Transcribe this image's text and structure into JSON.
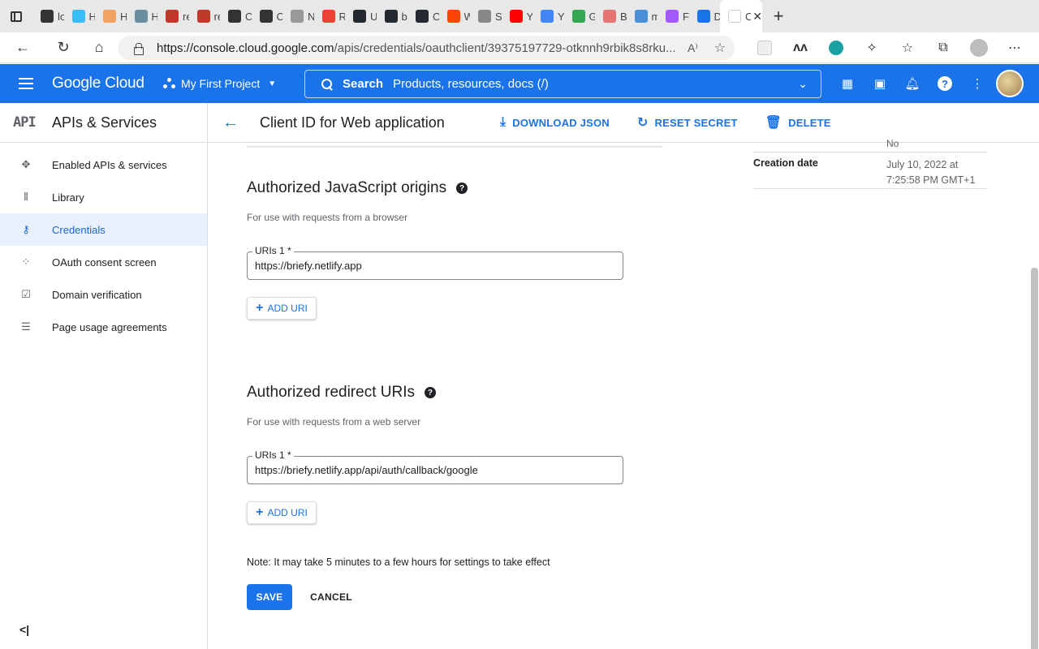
{
  "browser": {
    "tabs": [
      {
        "title": "loc",
        "color": "#333333"
      },
      {
        "title": "Ha",
        "color": "#38bdf8"
      },
      {
        "title": "Ho",
        "color": "#f4a261"
      },
      {
        "title": "Ho",
        "color": "#6b8e9f"
      },
      {
        "title": "re",
        "color": "#c0392b"
      },
      {
        "title": "re",
        "color": "#c0392b"
      },
      {
        "title": "Co",
        "color": "#333333"
      },
      {
        "title": "Co",
        "color": "#333333"
      },
      {
        "title": "Ne",
        "color": "#999999"
      },
      {
        "title": "Re",
        "color": "#ea4335"
      },
      {
        "title": "Us",
        "color": "#24292f"
      },
      {
        "title": "br",
        "color": "#24292f"
      },
      {
        "title": "Or",
        "color": "#24292f"
      },
      {
        "title": "W",
        "color": "#ff4500"
      },
      {
        "title": "Se",
        "color": "#888888"
      },
      {
        "title": "Yo",
        "color": "#ff0000"
      },
      {
        "title": "Yo",
        "color": "#4285f4"
      },
      {
        "title": "Go",
        "color": "#34a853"
      },
      {
        "title": "Bi",
        "color": "#e57373"
      },
      {
        "title": "ms",
        "color": "#4a90d9"
      },
      {
        "title": "Fig",
        "color": "#a259ff"
      },
      {
        "title": "De",
        "color": "#1a73e8"
      },
      {
        "title": "Cli",
        "color": "#ffffff"
      }
    ],
    "url_host": "https://console.cloud.google.com",
    "url_path": "/apis/credentials/oauthclient/39375197729-otknnh9rbik8s8rku..."
  },
  "header": {
    "logo": "Google Cloud",
    "project": "My First Project",
    "search_label": "Search",
    "search_placeholder": "Products, resources, docs (/)"
  },
  "sidebar": {
    "logo": "API",
    "title": "APIs & Services",
    "items": [
      {
        "label": "Enabled APIs & services",
        "icon": "✥"
      },
      {
        "label": "Library",
        "icon": "⦀"
      },
      {
        "label": "Credentials",
        "icon": "⚷"
      },
      {
        "label": "OAuth consent screen",
        "icon": "⁘"
      },
      {
        "label": "Domain verification",
        "icon": "☑"
      },
      {
        "label": "Page usage agreements",
        "icon": "☰"
      }
    ],
    "collapse_label": "<|"
  },
  "toolbar": {
    "title": "Client ID for Web application",
    "download": "DOWNLOAD JSON",
    "reset": "RESET SECRET",
    "delete": "DELETE"
  },
  "js_origins": {
    "title": "Authorized JavaScript origins",
    "desc": "For use with requests from a browser",
    "field_label": "URIs 1 *",
    "value": "https://briefy.netlify.app",
    "add_label": "ADD URI"
  },
  "redirect": {
    "title": "Authorized redirect URIs",
    "desc": "For use with requests from a web server",
    "field_label": "URIs 1 *",
    "value": "https://briefy.netlify.app/api/auth/callback/google",
    "add_label": "ADD URI"
  },
  "note": "Note: It may take 5 minutes to a few hours for settings to take effect",
  "save_label": "SAVE",
  "cancel_label": "CANCEL",
  "info": {
    "prev_value": "No",
    "creation_key": "Creation date",
    "creation_value": "July 10, 2022 at 7:25:58 PM GMT+1"
  },
  "colors": {
    "brand": "#1a73e8",
    "active_nav_bg": "#e8f0fe"
  }
}
